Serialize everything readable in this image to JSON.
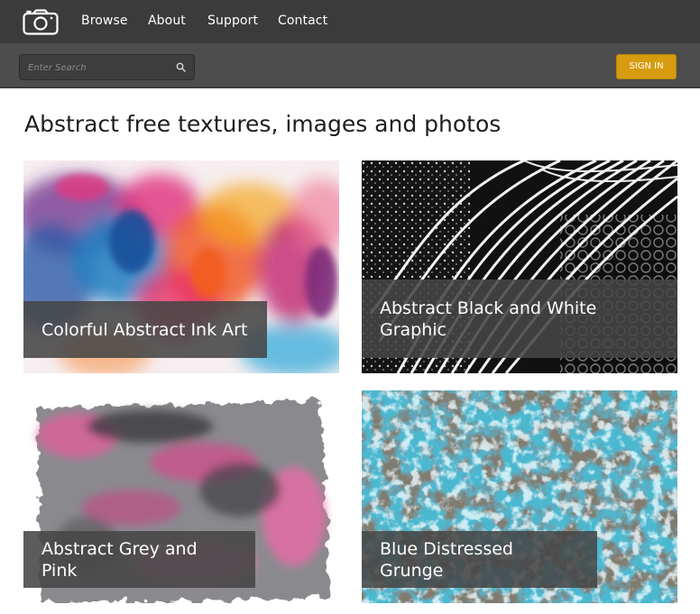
{
  "nav": {
    "logo_icon": "camera-icon",
    "links": [
      {
        "label": "Browse"
      },
      {
        "label": "About"
      },
      {
        "label": "Support"
      },
      {
        "label": "Contact"
      }
    ]
  },
  "search": {
    "placeholder": "Enter Search",
    "value": "",
    "icon": "search-icon"
  },
  "auth": {
    "signin_label": "SIGN IN"
  },
  "page": {
    "title": "Abstract free textures, images and photos"
  },
  "cards": [
    {
      "caption": "Colorful Abstract Ink Art"
    },
    {
      "caption": "Abstract Black and White Graphic"
    },
    {
      "caption": "Abstract Grey and Pink"
    },
    {
      "caption": "Blue Distressed Grunge"
    }
  ],
  "colors": {
    "nav_bg": "#3b3b3b",
    "search_bar_bg": "#4d4d4d",
    "signin_bg": "#d79b0f",
    "caption_bg": "#464646"
  }
}
